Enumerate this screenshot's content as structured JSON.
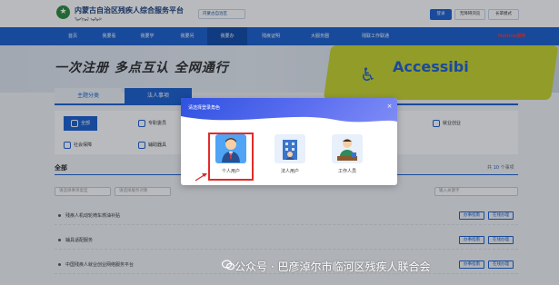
{
  "header": {
    "site_title": "内蒙古自治区残疾人综合服务平台",
    "site_subtitle": "ᠮᠣᠩᠭᠣᠯ ᠤᠯᠤᠰ",
    "region_select": "内蒙古自治区",
    "login": "登录",
    "accessibility": "无障碍浏览",
    "elder_mode": "长辈模式"
  },
  "nav": {
    "items": [
      "首页",
      "我要看",
      "我要学",
      "我要问",
      "我要办",
      "残疾证明",
      "大服务圈",
      "残联工作联通"
    ],
    "active_index": 4,
    "red_label": "Hotline服务"
  },
  "banner": {
    "slogan": "一次注册  多点互认  全网通行",
    "key_text": "Accessibi"
  },
  "category_tabs": [
    "主题分类",
    "法人事项"
  ],
  "categories": [
    {
      "label": "全部",
      "active": true
    },
    {
      "label": "专职委员"
    },
    {
      "label": "就业创业"
    },
    {
      "label": "社会保障"
    },
    {
      "label": "辅助器具"
    }
  ],
  "section": {
    "title": "全部",
    "count_prefix": "共",
    "count": "10",
    "count_suffix": "个事项",
    "filter1": "请选择事项类型",
    "filter2": "请选择服务对象",
    "search_placeholder": "输入关键字"
  },
  "rows": [
    {
      "title": "残疾人机动轮椅车燃油补贴",
      "btn1": "办事指南",
      "btn2": "在线办理"
    },
    {
      "title": "辅具适配服务",
      "btn1": "办事指南",
      "btn2": "在线办理"
    },
    {
      "title": "中国残疾人就业创业网络服务平台",
      "btn1": "办事指南",
      "btn2": "在线办理"
    }
  ],
  "modal": {
    "title": "请选择登录角色",
    "close": "×",
    "roles": [
      {
        "label": "个人用户",
        "icon": "person-icon",
        "selected": true
      },
      {
        "label": "法人用户",
        "icon": "building-icon"
      },
      {
        "label": "工作人员",
        "icon": "staff-icon"
      }
    ]
  },
  "watermark": "公众号 · 巴彦淖尔市临河区残疾人联合会",
  "colors": {
    "primary": "#1b5fcf",
    "modal_gradient_start": "#2f52e0",
    "highlight": "#e22b2b",
    "selected_role_bg": "#4fa4f5"
  }
}
